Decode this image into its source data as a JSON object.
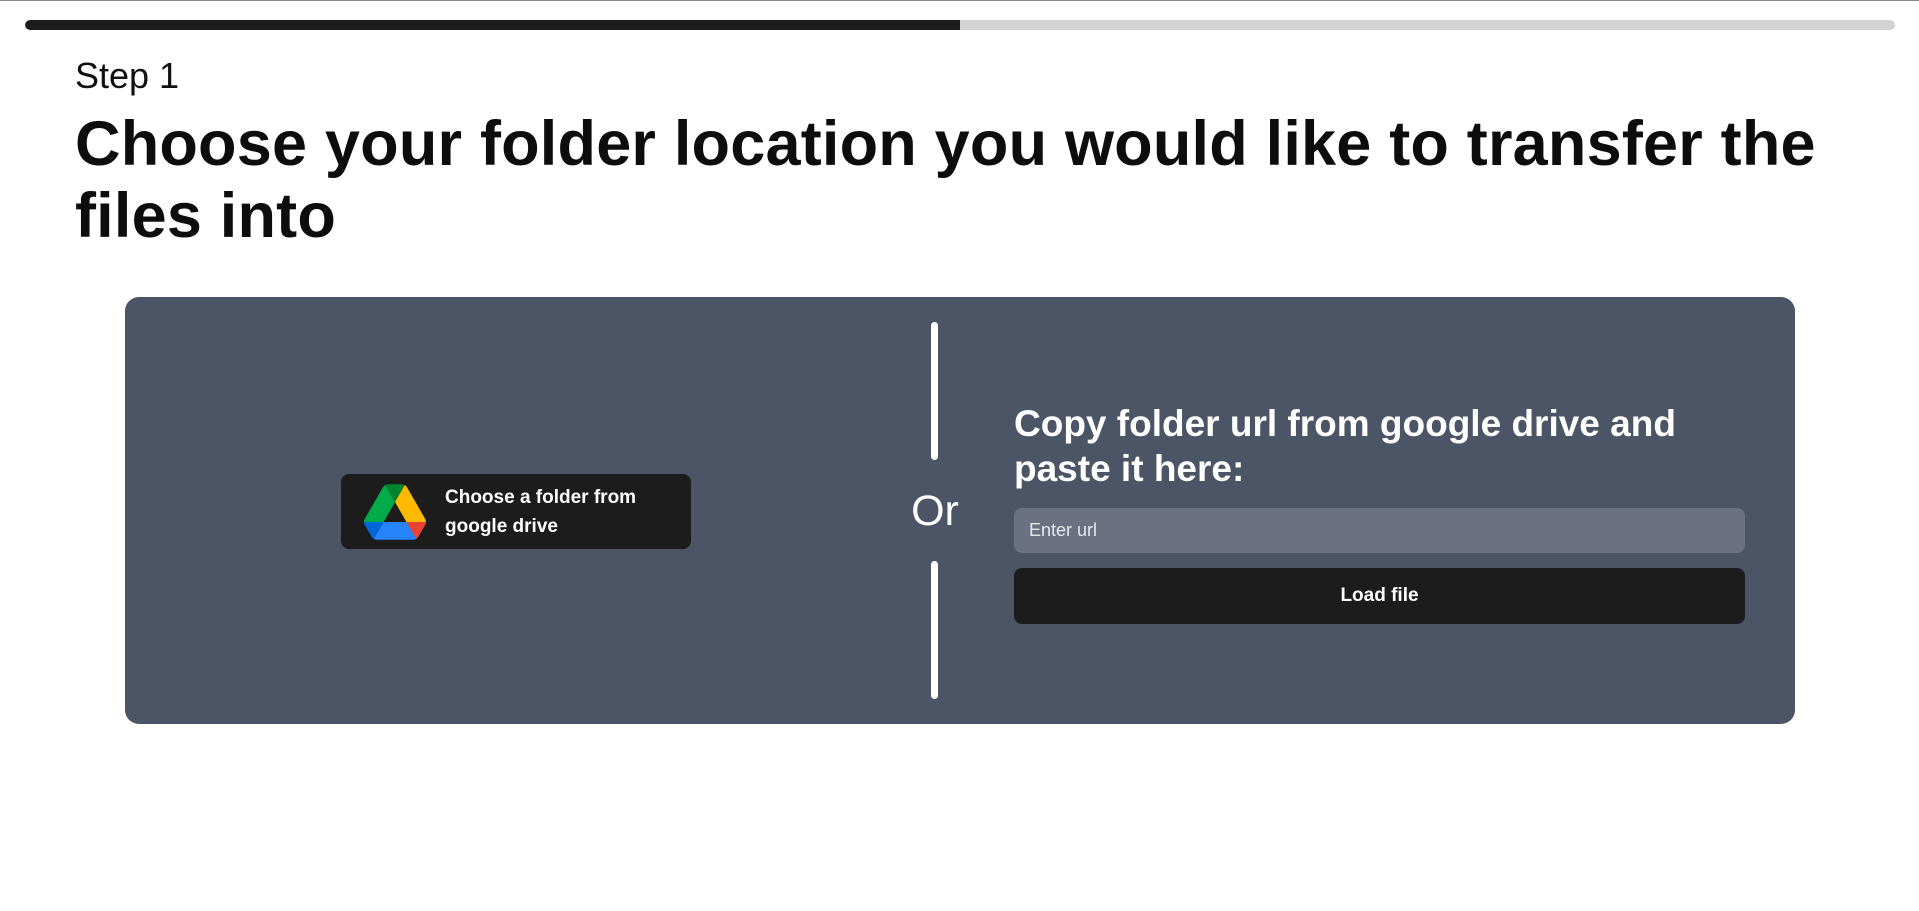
{
  "progress": {
    "fraction": 0.5,
    "fill_color": "#1c1c1c",
    "track_color": "#d3d3d3"
  },
  "header": {
    "step_label": "Step 1",
    "title": "Choose your folder location you would like to transfer the files into"
  },
  "panel": {
    "background_color": "#4b5566",
    "drive_button": {
      "label": "Choose a folder from google drive",
      "icon": "google-drive-icon"
    },
    "separator_label": "Or",
    "url_section": {
      "heading": "Copy folder url from google drive and paste it here:",
      "input_placeholder": "Enter url",
      "input_value": "",
      "load_button_label": "Load file"
    }
  }
}
